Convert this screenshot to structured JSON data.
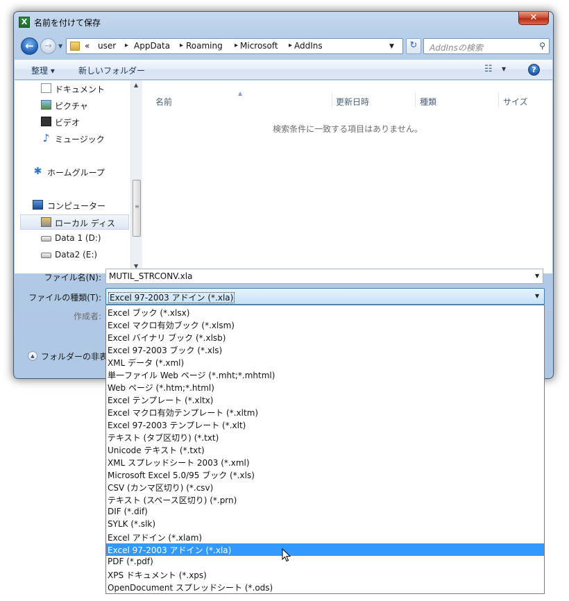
{
  "window": {
    "title": "名前を付けて保存",
    "app_icon": "X",
    "close": "✕"
  },
  "address": {
    "prefix": "«",
    "crumbs": [
      "user",
      "AppData",
      "Roaming",
      "Microsoft",
      "AddIns"
    ],
    "search_placeholder": "AddInsの検索"
  },
  "toolbar": {
    "organize": "整理 ▾",
    "new_folder": "新しいフォルダー"
  },
  "nav_pane": {
    "items": [
      "ドキュメント",
      "ピクチャ",
      "ビデオ",
      "ミュージック",
      "ホームグループ",
      "コンピューター",
      "ローカル ディス",
      "Data 1 (D:)",
      "Data2 (E:)"
    ],
    "icons": [
      "document-icon",
      "picture-icon",
      "video-icon",
      "music-icon",
      "homegroup-icon",
      "computer-icon",
      "local-disk-icon",
      "drive-icon",
      "drive-icon"
    ]
  },
  "file_list": {
    "columns": [
      "名前",
      "更新日時",
      "種類",
      "サイズ"
    ],
    "empty_message": "検索条件に一致する項目はありません。"
  },
  "form": {
    "filename_label": "ファイル名(N):",
    "filename_value": "MUTIL_STRCONV.xla",
    "filetype_label": "ファイルの種類(T):",
    "filetype_value": "Excel 97-2003 アドイン (*.xla)",
    "author_label": "作成者:",
    "hide_folders_label": "フォルダーの非表"
  },
  "filetype_options": [
    "Excel ブック (*.xlsx)",
    "Excel マクロ有効ブック (*.xlsm)",
    "Excel バイナリ ブック (*.xlsb)",
    "Excel 97-2003 ブック (*.xls)",
    "XML データ (*.xml)",
    "単一ファイル Web ページ (*.mht;*.mhtml)",
    "Web ページ (*.htm;*.html)",
    "Excel テンプレート (*.xltx)",
    "Excel マクロ有効テンプレート (*.xltm)",
    "Excel 97-2003 テンプレート (*.xlt)",
    "テキスト (タブ区切り) (*.txt)",
    "Unicode テキスト (*.txt)",
    "XML スプレッドシート 2003 (*.xml)",
    "Microsoft Excel 5.0/95 ブック (*.xls)",
    "CSV (カンマ区切り) (*.csv)",
    "テキスト (スペース区切り) (*.prn)",
    "DIF (*.dif)",
    "SYLK (*.slk)",
    "Excel アドイン (*.xlam)",
    "Excel 97-2003 アドイン (*.xla)",
    "PDF (*.pdf)",
    "XPS ドキュメント (*.xps)",
    "OpenDocument スプレッドシート (*.ods)"
  ],
  "selected_option_index": 19
}
